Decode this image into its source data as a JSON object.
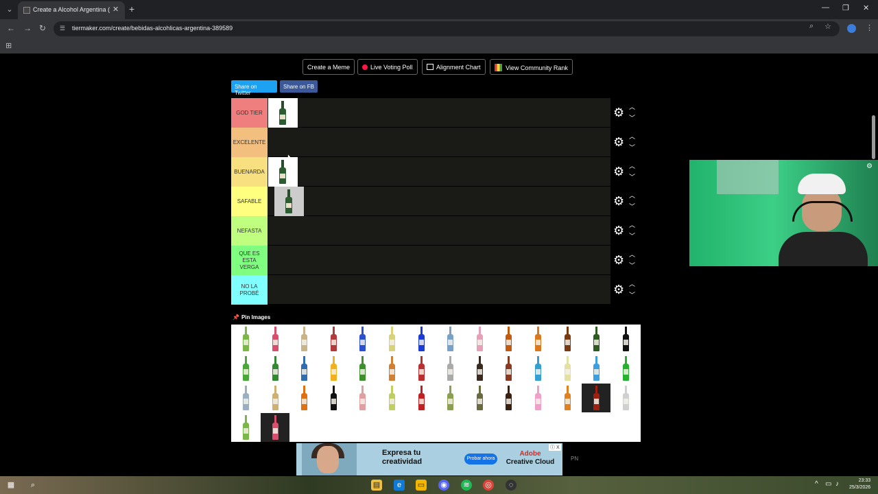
{
  "browser": {
    "tab_title": "Create a Alcohol Argentina (Es",
    "url": "tiermaker.com/create/bebidas-alcohlicas-argentina-389589",
    "icons": [
      "tab-menu-icon",
      "close-icon",
      "plus-icon",
      "back-icon",
      "forward-icon",
      "reload-icon",
      "site-info-icon",
      "zoom-icon",
      "star-icon",
      "kebab-icon",
      "apps-icon"
    ]
  },
  "toolbar": {
    "create_meme": "Create a Meme",
    "live_voting": "Live Voting Poll",
    "alignment": "Alignment Chart",
    "community_rank": "View Community Rank"
  },
  "share": {
    "twitter": "Share on Twitter",
    "facebook": "Share on FB"
  },
  "tiers": [
    {
      "label": "GOD TIER",
      "color": "#ef7f7f",
      "items": 1
    },
    {
      "label": "EXCELENTE",
      "color": "#f3bf7f",
      "items": 0
    },
    {
      "label": "BUENARDA",
      "color": "#f8df7f",
      "items": 1
    },
    {
      "label": "SAFABLE",
      "color": "#fefe7f",
      "items": 1
    },
    {
      "label": "NEFASTA",
      "color": "#bffe7f",
      "items": 0
    },
    {
      "label": "QUE ES ESTA VERGA",
      "color": "#7ffe7f",
      "items": 0
    },
    {
      "label": "NO LA PROBÉ",
      "color": "#7fffff",
      "items": 0
    }
  ],
  "pool": {
    "title": "Pin Images",
    "item_count": 44
  },
  "ad": {
    "headline_1": "Expresa tu",
    "headline_2": "creatividad",
    "cta": "Probar ahora",
    "brand_1": "Adobe",
    "brand_2": "Creative Cloud",
    "close": "ⓘ X",
    "side_text": "PN"
  },
  "taskbar": {
    "time": "23:33",
    "date": "25/3/2026"
  }
}
